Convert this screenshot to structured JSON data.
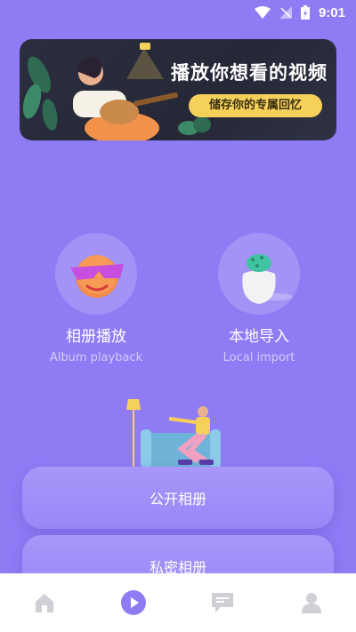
{
  "status_bar": {
    "time": "9:01"
  },
  "banner": {
    "title": "播放你想看的视频",
    "subtitle": "储存你的专属回忆"
  },
  "features": [
    {
      "label": "相册播放",
      "label_en": "Album playback"
    },
    {
      "label": "本地导入",
      "label_en": "Local import"
    }
  ],
  "cards": {
    "public_album": "公开相册",
    "private_album": "私密相册"
  },
  "nav": {
    "items": [
      "home-icon",
      "play-icon",
      "message-icon",
      "profile-icon"
    ],
    "active_color": "#8f7cf5",
    "inactive_color": "#cfcfd6"
  }
}
